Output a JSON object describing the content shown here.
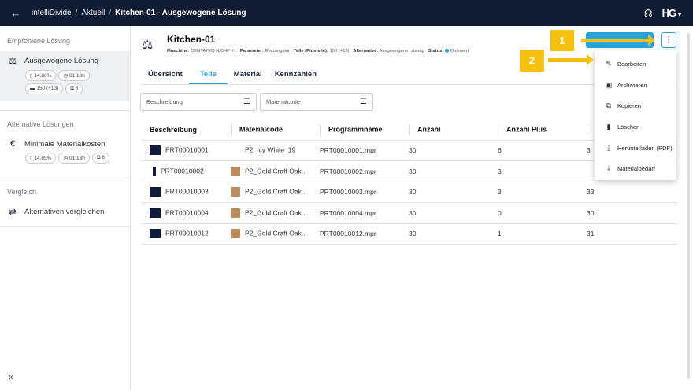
{
  "topbar": {
    "app": "intelliDivide",
    "crumb": "Aktuell",
    "current": "Kitchen-01 - Ausgewogene Lösung",
    "logo": "HG"
  },
  "sidebar": {
    "recommended_title": "Empfohlene Lösung",
    "recommended": {
      "label": "Ausgewogene Lösung",
      "chips": [
        "14,86%",
        "01:18h",
        "150 (+13)",
        "6"
      ]
    },
    "alternatives_title": "Alternative Lösungen",
    "alternative": {
      "label": "Minimale Materialkosten",
      "chips": [
        "14,85%",
        "01:13h",
        "6"
      ]
    },
    "compare_title": "Vergleich",
    "compare_label": "Alternativen vergleichen",
    "collapse": "«"
  },
  "header": {
    "title": "Kitchen-01",
    "machine_label": "Maschine:",
    "machine": "CENTATEQ N/BHP #1",
    "parameter_label": "Parameter:",
    "parameter": "Rectangular",
    "parts_label": "Teile (Plusteile):",
    "parts": "150 (+13)",
    "alternative_label": "Alternative:",
    "alternative": "Ausgewogene Lösung",
    "status_label": "Status:",
    "status": "Optimiert"
  },
  "tabs": [
    "Übersicht",
    "Teile",
    "Material",
    "Kennzahlen"
  ],
  "filters": {
    "description": "Beschreibung",
    "material": "Materialcode"
  },
  "table": {
    "headers": [
      "Beschreibung",
      "Materialcode",
      "Programmname",
      "Anzahl",
      "Anzahl Plus",
      ""
    ],
    "rows": [
      {
        "desc": "PRT00010001",
        "mat": "P2_Icy White_19",
        "prog": "PRT00010001.mpr",
        "qty": "30",
        "plus": "6",
        "last": "3"
      },
      {
        "desc": "PRT00010002",
        "mat": "P2_Gold Craft Oak...",
        "prog": "PRT00010002.mpr",
        "qty": "30",
        "plus": "3",
        "last": ""
      },
      {
        "desc": "PRT00010003",
        "mat": "P2_Gold Craft Oak...",
        "prog": "PRT00010003.mpr",
        "qty": "30",
        "plus": "3",
        "last": "33"
      },
      {
        "desc": "PRT00010004",
        "mat": "P2_Gold Craft Oak...",
        "prog": "PRT00010004.mpr",
        "qty": "30",
        "plus": "0",
        "last": "30"
      },
      {
        "desc": "PRT00010012",
        "mat": "P2_Gold Craft Oak...",
        "prog": "PRT00010012.mpr",
        "qty": "30",
        "plus": "1",
        "last": "31"
      }
    ]
  },
  "menu": {
    "items": [
      {
        "label": "Bearbeiten",
        "icon": "pencil-icon"
      },
      {
        "label": "Archivieren",
        "icon": "archive-icon"
      },
      {
        "label": "Kopieren",
        "icon": "copy-icon"
      },
      {
        "label": "Löschen",
        "icon": "trash-icon"
      },
      {
        "label": "Herunterladen (PDF)",
        "icon": "download-icon"
      },
      {
        "label": "Materialbedarf",
        "icon": "download-icon"
      }
    ]
  },
  "callouts": [
    "1",
    "2"
  ],
  "colors": {
    "accent": "#2ba3d9",
    "topbar": "#0f1c33",
    "callout": "#f5c010"
  }
}
